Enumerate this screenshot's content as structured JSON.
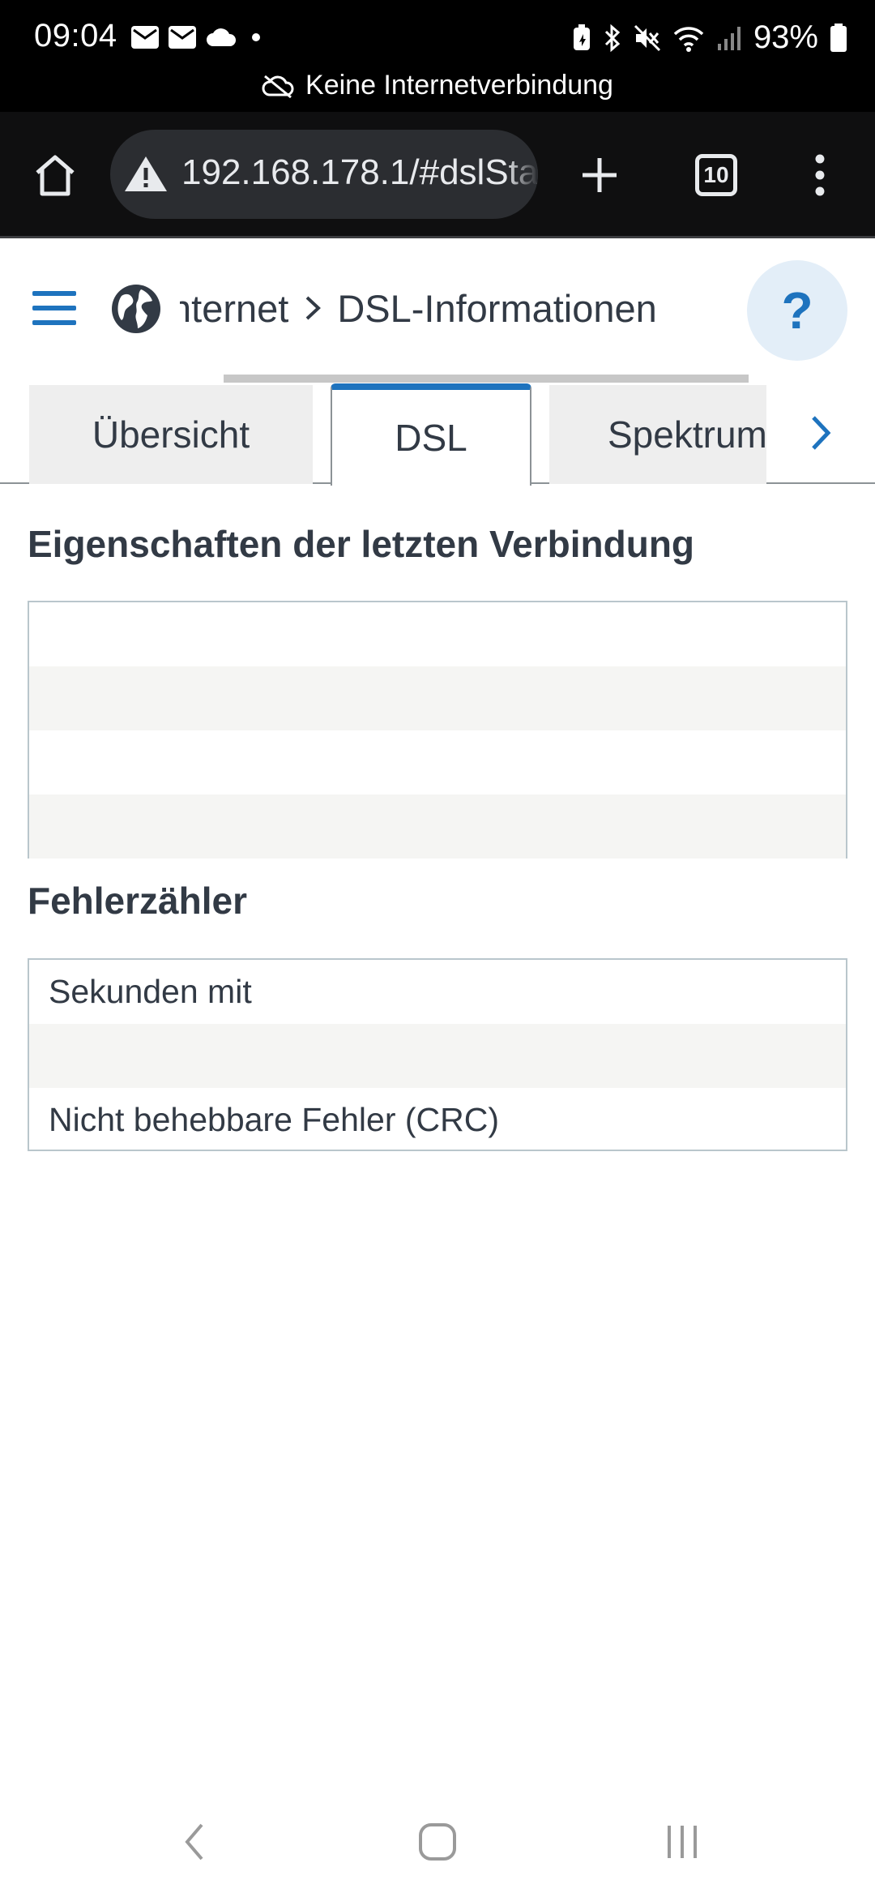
{
  "status_bar": {
    "time": "09:04",
    "battery": "93%",
    "offline_notice": "Keine Internetverbindung",
    "icons": [
      "mail-icon",
      "mail-icon",
      "cloud-icon",
      "dot-icon",
      "battery-saver-icon",
      "bluetooth-icon",
      "mute-icon",
      "wifi-icon",
      "signal-icon",
      "battery-icon"
    ]
  },
  "browser": {
    "url": "192.168.178.1/#dslSta",
    "tab_count": "10",
    "icons": [
      "home-icon",
      "warning-icon",
      "plus-icon",
      "tab-switcher-icon",
      "more-vert-icon"
    ]
  },
  "header": {
    "breadcrumb": [
      "nternet",
      "DSL-Informationen"
    ],
    "breadcrumb_separator": "›",
    "help": "?",
    "icons": [
      "hamburger-icon",
      "globe-icon"
    ]
  },
  "tabs": {
    "items": [
      {
        "label": "Übersicht",
        "active": false
      },
      {
        "label": "DSL",
        "active": true
      },
      {
        "label": "Spektrum",
        "active": false
      }
    ],
    "next_icon": "chevron-right-icon"
  },
  "content": {
    "properties_title": "Eigenschaften der letzten Verbindung",
    "properties_rows": [
      "",
      "",
      "",
      ""
    ],
    "errors_title": "Fehlerzähler",
    "errors_rows": [
      "Sekunden mit",
      "",
      "Nicht behebbare Fehler (CRC)"
    ]
  },
  "nav": {
    "icons": [
      "back-icon",
      "home-circle-icon",
      "recents-icon"
    ]
  },
  "colors": {
    "accent": "#1e73be",
    "status_bg": "#000000",
    "toolbar_bg": "#0f0f10",
    "text": "#323a45"
  }
}
